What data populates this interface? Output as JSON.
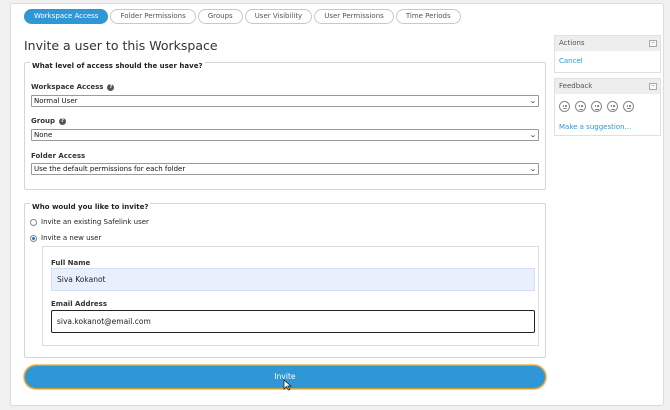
{
  "tabs": [
    {
      "label": "Workspace Access",
      "active": true
    },
    {
      "label": "Folder Permissions",
      "active": false
    },
    {
      "label": "Groups",
      "active": false
    },
    {
      "label": "User Visibility",
      "active": false
    },
    {
      "label": "User Permissions",
      "active": false
    },
    {
      "label": "Time Periods",
      "active": false
    }
  ],
  "title": "Invite a user to this Workspace",
  "access_section": {
    "legend": "What level of access should the user have?",
    "workspace_access": {
      "label": "Workspace Access",
      "value": "Normal User"
    },
    "group": {
      "label": "Group",
      "value": "None"
    },
    "folder_access": {
      "label": "Folder Access",
      "value": "Use the default permissions for each folder"
    }
  },
  "invite_section": {
    "legend": "Who would you like to invite?",
    "option_existing": "Invite an existing Safelink user",
    "option_new": "Invite a new user",
    "selected": "new",
    "full_name": {
      "label": "Full Name",
      "value": "Siva Kokanot"
    },
    "email": {
      "label": "Email Address",
      "value": "siva.kokanot@email.com"
    }
  },
  "invite_button": "Invite",
  "sidebar": {
    "actions": {
      "title": "Actions",
      "cancel": "Cancel"
    },
    "feedback": {
      "title": "Feedback",
      "suggestion": "Make a suggestion...",
      "faces": [
        "very-sad-face-icon",
        "sad-face-icon",
        "neutral-face-icon",
        "smile-face-icon",
        "happy-face-icon"
      ]
    }
  },
  "colors": {
    "accent": "#2f97d6",
    "autofill": "#e8f0fe"
  }
}
